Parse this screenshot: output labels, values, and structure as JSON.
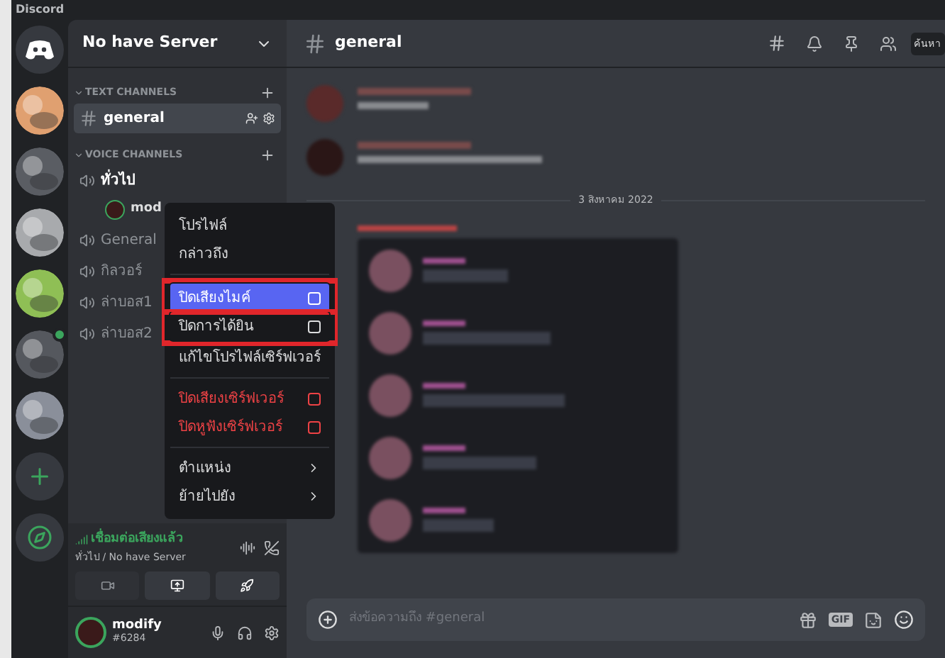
{
  "window": {
    "title": "Discord"
  },
  "servers": [
    {
      "kind": "home"
    },
    {
      "kind": "picture",
      "badge": false
    },
    {
      "kind": "picture",
      "badge": false
    },
    {
      "kind": "picture",
      "badge": false
    },
    {
      "kind": "picture",
      "badge": false
    },
    {
      "kind": "picture",
      "badge": true
    },
    {
      "kind": "picture",
      "badge": false
    },
    {
      "kind": "add"
    },
    {
      "kind": "explore"
    }
  ],
  "sidebar": {
    "server_name": "No have Server",
    "categories": [
      {
        "name": "TEXT CHANNELS",
        "expanded": true,
        "channels": [
          {
            "name": "general",
            "kind": "text",
            "selected": true
          }
        ]
      },
      {
        "name": "VOICE CHANNELS",
        "expanded": true,
        "channels": [
          {
            "name": "ทั่วไป",
            "kind": "voice",
            "selected": false,
            "active": true,
            "members": [
              {
                "name": "mod"
              }
            ]
          },
          {
            "name": "General",
            "kind": "voice",
            "selected": false,
            "active": false
          },
          {
            "name": "กิลวอร์",
            "kind": "voice",
            "selected": false,
            "active": false
          },
          {
            "name": "ล่าบอส1",
            "kind": "voice",
            "selected": false,
            "active": false
          },
          {
            "name": "ล่าบอส2",
            "kind": "voice",
            "selected": false,
            "active": false
          }
        ]
      }
    ]
  },
  "voice_panel": {
    "status": "เชื่อมต่อเสียงแล้ว",
    "location": "ทั่วไป / No have Server"
  },
  "user": {
    "name": "modify",
    "tag": "#6284"
  },
  "context_menu": {
    "sections": [
      [
        {
          "label": "โปรไฟล์",
          "kind": "item",
          "danger": false,
          "highlighted": false,
          "outlined": false
        },
        {
          "label": "กล่าวถึง",
          "kind": "item",
          "danger": false,
          "highlighted": false,
          "outlined": false
        }
      ],
      [
        {
          "label": "ปิดเสียงไมค์",
          "kind": "check",
          "checked": false,
          "danger": false,
          "highlighted": true,
          "outlined": true
        },
        {
          "label": "ปิดการได้ยิน",
          "kind": "check",
          "checked": false,
          "danger": false,
          "highlighted": false,
          "outlined": true
        },
        {
          "label": "แก้ไขโปรไฟล์เซิร์ฟเวอร์",
          "kind": "item",
          "danger": false,
          "highlighted": false,
          "outlined": false
        }
      ],
      [
        {
          "label": "ปิดเสียงเซิร์ฟเวอร์",
          "kind": "check",
          "checked": false,
          "danger": true,
          "highlighted": false,
          "outlined": false
        },
        {
          "label": "ปิดหูฟังเซิร์ฟเวอร์",
          "kind": "check",
          "checked": false,
          "danger": true,
          "highlighted": false,
          "outlined": false
        }
      ],
      [
        {
          "label": "ตำแหน่ง",
          "kind": "submenu",
          "danger": false,
          "highlighted": false,
          "outlined": false
        },
        {
          "label": "ย้ายไปยัง",
          "kind": "submenu",
          "danger": false,
          "highlighted": false,
          "outlined": false
        }
      ]
    ]
  },
  "chat": {
    "channel": "general",
    "search": {
      "placeholder": "ค้นหา"
    },
    "date_divider": "3 สิงหาคม 2022",
    "composer": {
      "placeholder": "ส่งข้อความถึง #general",
      "gif_button": "GIF"
    }
  }
}
